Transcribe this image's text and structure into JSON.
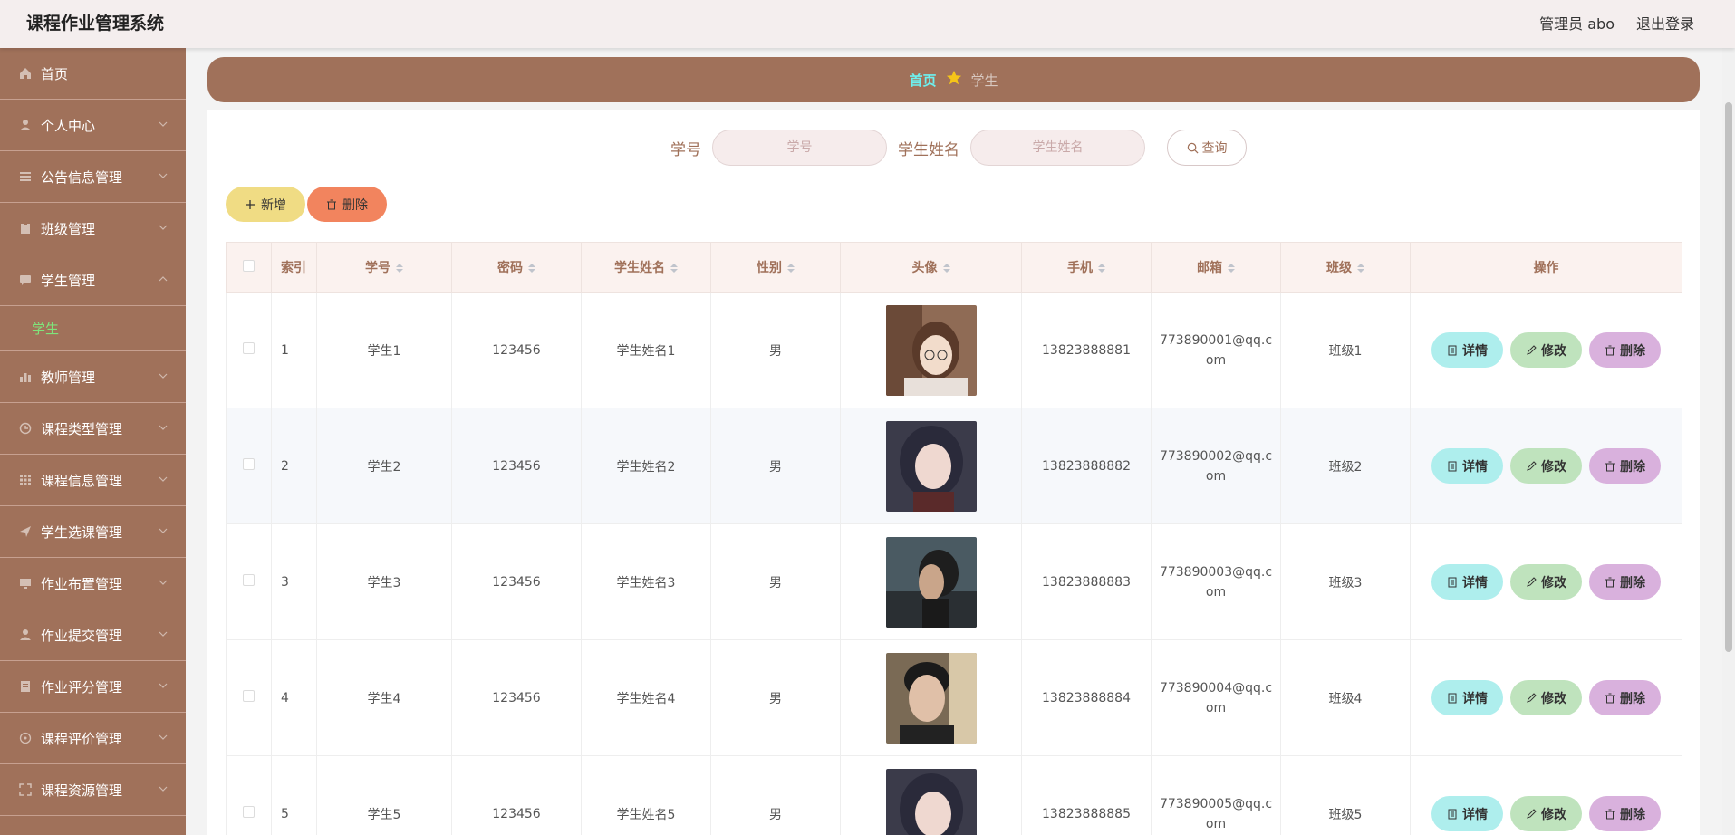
{
  "app": {
    "title": "课程作业管理系统",
    "user": "管理员 abo",
    "logout": "退出登录"
  },
  "sidebar": {
    "items": [
      {
        "label": "首页",
        "icon": "home-icon"
      },
      {
        "label": "个人中心",
        "icon": "user-icon"
      },
      {
        "label": "公告信息管理",
        "icon": "list-icon"
      },
      {
        "label": "班级管理",
        "icon": "clipboard-icon"
      },
      {
        "label": "学生管理",
        "icon": "chat-icon"
      },
      {
        "label": "教师管理",
        "icon": "bar-chart-icon"
      },
      {
        "label": "课程类型管理",
        "icon": "clock-icon"
      },
      {
        "label": "课程信息管理",
        "icon": "grid-icon"
      },
      {
        "label": "学生选课管理",
        "icon": "send-icon"
      },
      {
        "label": "作业布置管理",
        "icon": "monitor-icon"
      },
      {
        "label": "作业提交管理",
        "icon": "user-icon"
      },
      {
        "label": "作业评分管理",
        "icon": "document-icon"
      },
      {
        "label": "课程评价管理",
        "icon": "target-icon"
      },
      {
        "label": "课程资源管理",
        "icon": "fullscreen-icon"
      }
    ],
    "active_sub": "学生"
  },
  "breadcrumb": {
    "home": "首页",
    "current": "学生"
  },
  "search": {
    "id_label": "学号",
    "id_placeholder": "学号",
    "name_label": "学生姓名",
    "name_placeholder": "学生姓名",
    "query_button": "查询"
  },
  "actions": {
    "add": "新增",
    "delete": "删除"
  },
  "table": {
    "headers": [
      "索引",
      "学号",
      "密码",
      "学生姓名",
      "性别",
      "头像",
      "手机",
      "邮箱",
      "班级",
      "操作"
    ],
    "rows": [
      {
        "index": "1",
        "id": "学生1",
        "password": "123456",
        "name": "学生姓名1",
        "gender": "男",
        "phone": "13823888881",
        "email": "773890001@qq.com",
        "class": "班级1"
      },
      {
        "index": "2",
        "id": "学生2",
        "password": "123456",
        "name": "学生姓名2",
        "gender": "男",
        "phone": "13823888882",
        "email": "773890002@qq.com",
        "class": "班级2"
      },
      {
        "index": "3",
        "id": "学生3",
        "password": "123456",
        "name": "学生姓名3",
        "gender": "男",
        "phone": "13823888883",
        "email": "773890003@qq.com",
        "class": "班级3"
      },
      {
        "index": "4",
        "id": "学生4",
        "password": "123456",
        "name": "学生姓名4",
        "gender": "男",
        "phone": "13823888884",
        "email": "773890004@qq.com",
        "class": "班级4"
      },
      {
        "index": "5",
        "id": "学生5",
        "password": "123456",
        "name": "学生姓名5",
        "gender": "男",
        "phone": "13823888885",
        "email": "773890005@qq.com",
        "class": "班级5"
      }
    ],
    "row_actions": {
      "detail": "详情",
      "edit": "修改",
      "remove": "删除"
    }
  },
  "colors": {
    "brand": "#a0715a",
    "active_sub": "#7fe47b",
    "breadcrumb_home": "#6ef0ef"
  }
}
